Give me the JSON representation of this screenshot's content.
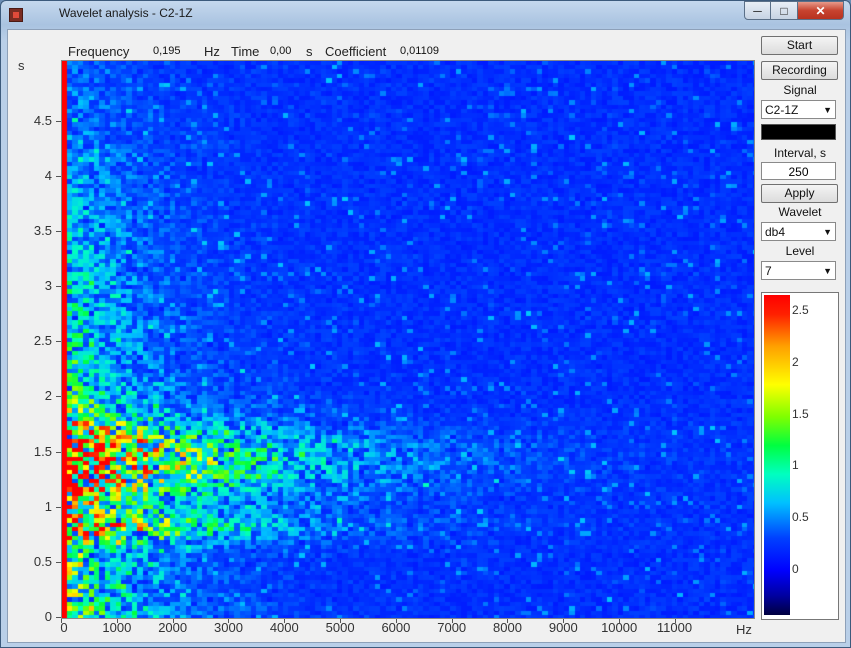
{
  "window": {
    "title": "Wavelet analysis - C2-1Z",
    "minimize_icon": "minimize-icon",
    "maximize_icon": "maximize-icon",
    "close_icon": "close-icon"
  },
  "info": {
    "frequency_label": "Frequency",
    "frequency_value": "0,195",
    "frequency_unit": "Hz",
    "time_label": "Time",
    "time_value": "0,00",
    "time_unit": "s",
    "coefficient_label": "Coefficient",
    "coefficient_value": "0,01109"
  },
  "controls": {
    "start": "Start",
    "recording": "Recording",
    "signal_label": "Signal",
    "signal_value": "C2-1Z",
    "interval_label": "Interval, s",
    "interval_value": "250",
    "apply": "Apply",
    "wavelet_label": "Wavelet",
    "wavelet_value": "db4",
    "level_label": "Level",
    "level_value": "7",
    "signal_color": "#000000"
  },
  "chart_data": {
    "type": "heatmap",
    "ylabel": "s",
    "xlabel": "Hz",
    "xlim": [
      0,
      12400
    ],
    "ylim": [
      0,
      5.05
    ],
    "yticks": [
      "0",
      "0.5",
      "1",
      "1.5",
      "2",
      "2.5",
      "3",
      "3.5",
      "4",
      "4.5"
    ],
    "xticks": [
      "0",
      "1000",
      "2000",
      "3000",
      "4000",
      "5000",
      "6000",
      "7000",
      "8000",
      "9000",
      "10000",
      "11000"
    ],
    "colorbar_ticks": [
      "0",
      "0.5",
      "1",
      "1.5",
      "2",
      "2.5"
    ],
    "colorbar_range": [
      -0.45,
      2.65
    ]
  }
}
